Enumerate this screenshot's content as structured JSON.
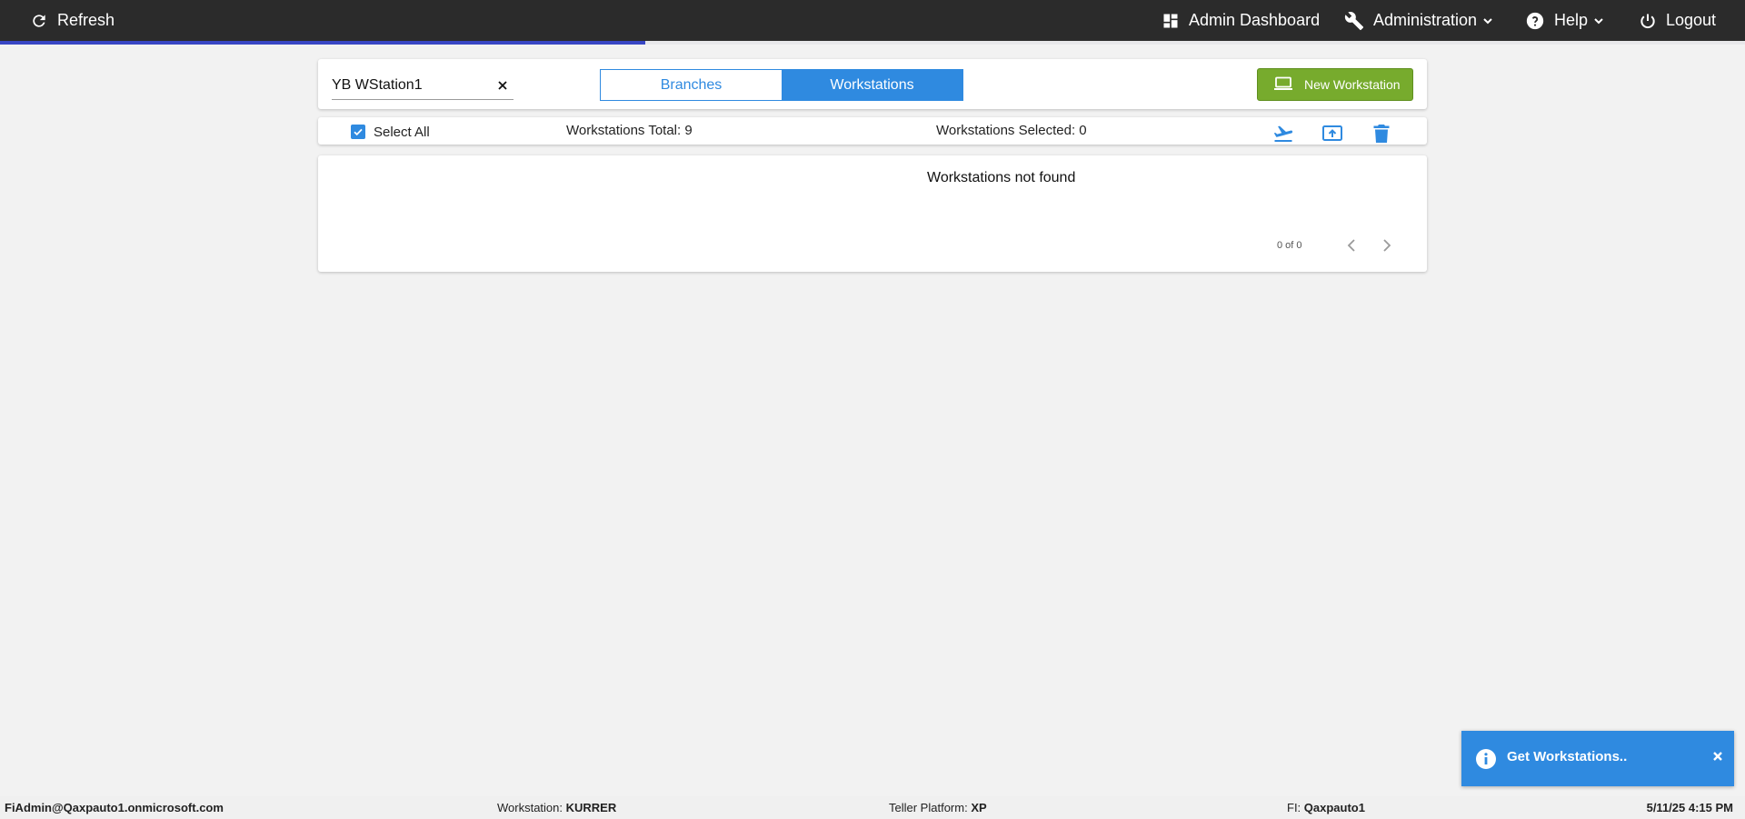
{
  "topbar": {
    "refresh_label": "Refresh",
    "admin_dashboard_label": "Admin Dashboard",
    "administration_label": "Administration",
    "help_label": "Help",
    "logout_label": "Logout",
    "progress_fraction": 0.37
  },
  "search": {
    "value": "YB WStation1",
    "placeholder": ""
  },
  "view_toggle": {
    "branches_label": "Branches",
    "workstations_label": "Workstations",
    "selected": "Workstations"
  },
  "new_workstation_label": "New Workstation",
  "toolbar": {
    "select_all_label": "Select All",
    "select_all_checked": true,
    "total_label": "Workstations Total: 9",
    "selected_label": "Workstations Selected: 0",
    "actions": [
      "transfer-icon",
      "upload-icon",
      "trash-icon"
    ]
  },
  "results": {
    "empty_message": "Workstations not found",
    "pager_text": "0 of 0"
  },
  "toast": {
    "message": "Get Workstations..",
    "close_symbol": "×"
  },
  "statusbar": {
    "user": "FiAdmin@Qaxpauto1.onmicrosoft.com",
    "workstation_label": "Workstation: ",
    "workstation_value": "KURRER",
    "teller_label": "Teller Platform: ",
    "teller_value": "XP",
    "fi_label": "FI: ",
    "fi_value": "Qaxpauto1",
    "datetime": "5/11/25 4:15 PM"
  },
  "colors": {
    "accent": "#2f8ae0",
    "topbar": "#2b2b2b",
    "success": "#77ab2d",
    "progress": "#3846c4",
    "background": "#f2f2f2"
  }
}
